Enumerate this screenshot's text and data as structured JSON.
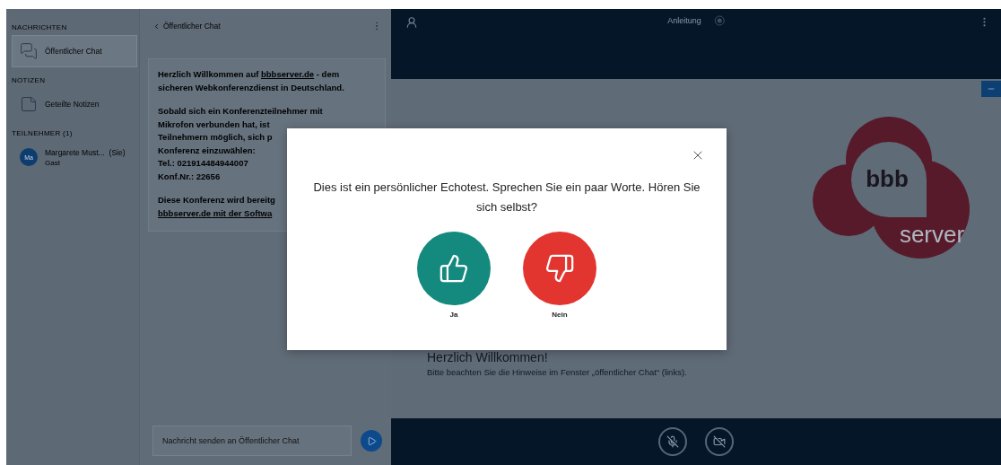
{
  "sidebar": {
    "sections": [
      {
        "heading": "NACHRICHTEN",
        "items": [
          {
            "kind": "chat",
            "label": "Öffentlicher Chat",
            "selected": true
          }
        ]
      },
      {
        "heading": "NOTIZEN",
        "items": [
          {
            "kind": "notes",
            "label": "Geteilte Notizen",
            "selected": false
          }
        ]
      },
      {
        "heading": "TEILNEHMER (1)",
        "items": [
          {
            "kind": "user",
            "avatar": "Ma",
            "label": "Margarete Must...",
            "suffix": "(Sie)",
            "role": "Gast",
            "selected": false
          }
        ]
      }
    ]
  },
  "chat": {
    "title": "Öffentlicher Chat",
    "paragraphs": [
      [
        [
          {
            "text": "Herzlich Willkommen auf "
          },
          {
            "text": "bbbserver.de",
            "link": true
          },
          {
            "text": " - dem"
          }
        ],
        [
          {
            "text": "sicheren Webkonferenzdienst in Deutschland."
          }
        ]
      ],
      [
        [
          {
            "text": "Sobald sich ein Konferenzteilnehmer mit"
          }
        ],
        [
          {
            "text": "Mikrofon verbunden hat, ist"
          }
        ],
        [
          {
            "text": "Teilnehmern möglich, sich p"
          }
        ],
        [
          {
            "text": "Konferenz einzuwählen:"
          }
        ],
        [
          {
            "text": "Tel.: 021914484944007"
          }
        ],
        [
          {
            "text": "Konf.Nr.: 22656"
          }
        ]
      ],
      [
        [
          {
            "text": "Diese Konferenz wird bereitg"
          }
        ],
        [
          {
            "text": "bbbserver.de mit der Softwa",
            "link": true
          }
        ]
      ]
    ],
    "placeholder": "Nachricht senden an Öffentlicher Chat"
  },
  "presentation": {
    "title": "Anleitung",
    "logo_top": "bbb",
    "logo_bottom": "server",
    "heading": "Herzlich Willkommen!",
    "note": "Bitte beachten Sie die Hinweise im Fenster „öffentlicher Chat“ (links)."
  },
  "dialog": {
    "message": "Dies ist ein persönlicher Echotest. Sprechen Sie ein paar Worte. Hören Sie sich selbst?",
    "options": [
      {
        "kind": "yes",
        "label": "Ja"
      },
      {
        "kind": "no",
        "label": "Nein"
      }
    ]
  }
}
